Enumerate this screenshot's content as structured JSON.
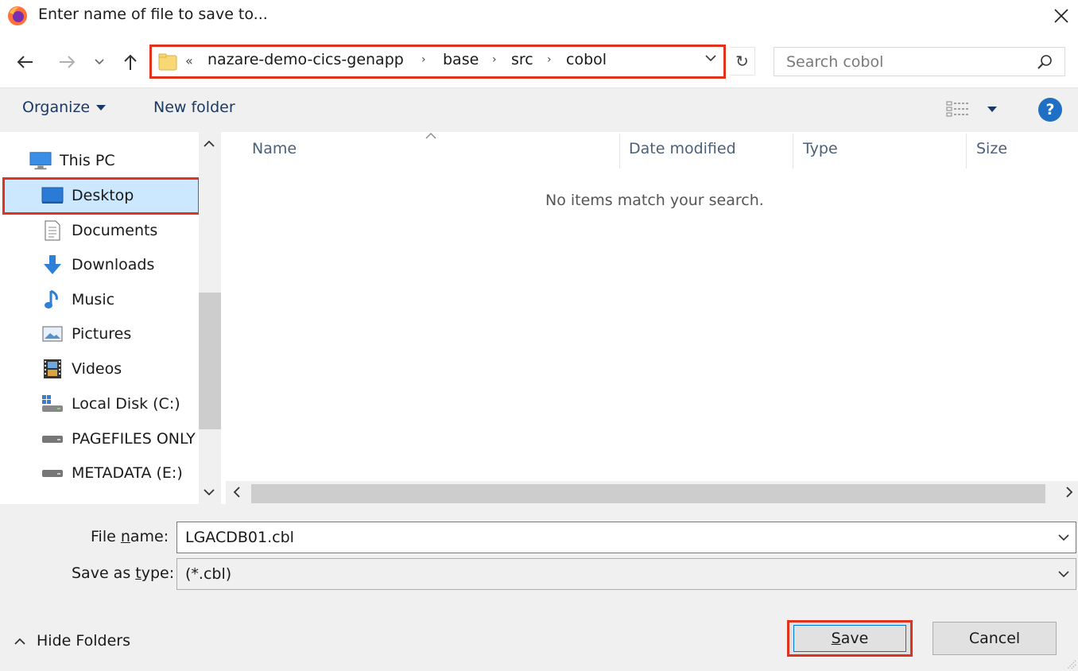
{
  "window": {
    "title": "Enter name of file to save to..."
  },
  "address": {
    "overflow_marker": "«",
    "crumbs": [
      "nazare-demo-cics-genapp",
      "base",
      "src",
      "cobol"
    ]
  },
  "search": {
    "placeholder": "Search cobol"
  },
  "toolbar": {
    "organize_label": "Organize",
    "new_folder_label": "New folder"
  },
  "nav": {
    "root": "This PC",
    "items": [
      {
        "label": "Desktop",
        "icon": "desktop-icon",
        "selected": true
      },
      {
        "label": "Documents",
        "icon": "documents-icon"
      },
      {
        "label": "Downloads",
        "icon": "downloads-icon"
      },
      {
        "label": "Music",
        "icon": "music-icon"
      },
      {
        "label": "Pictures",
        "icon": "pictures-icon"
      },
      {
        "label": "Videos",
        "icon": "videos-icon"
      },
      {
        "label": "Local Disk (C:)",
        "icon": "local-disk-icon"
      },
      {
        "label": "PAGEFILES ONLY",
        "icon": "drive-icon"
      },
      {
        "label": "METADATA (E:)",
        "icon": "drive-icon"
      }
    ]
  },
  "filelist": {
    "columns": [
      "Name",
      "Date modified",
      "Type",
      "Size"
    ],
    "empty_message": "No items match your search."
  },
  "form": {
    "filename_label_pre": "File ",
    "filename_label_key": "n",
    "filename_label_post": "ame:",
    "filename_value": "LGACDB01.cbl",
    "savetype_label_pre": "Save as ",
    "savetype_label_key": "t",
    "savetype_label_post": "ype:",
    "savetype_value": "(*.cbl)"
  },
  "footer": {
    "hide_folders_label": "Hide Folders",
    "save_key": "S",
    "save_rest": "ave",
    "cancel_label": "Cancel"
  },
  "colors": {
    "highlight": "#e0331f",
    "selection": "#cce8ff",
    "accent": "#0078d7"
  }
}
